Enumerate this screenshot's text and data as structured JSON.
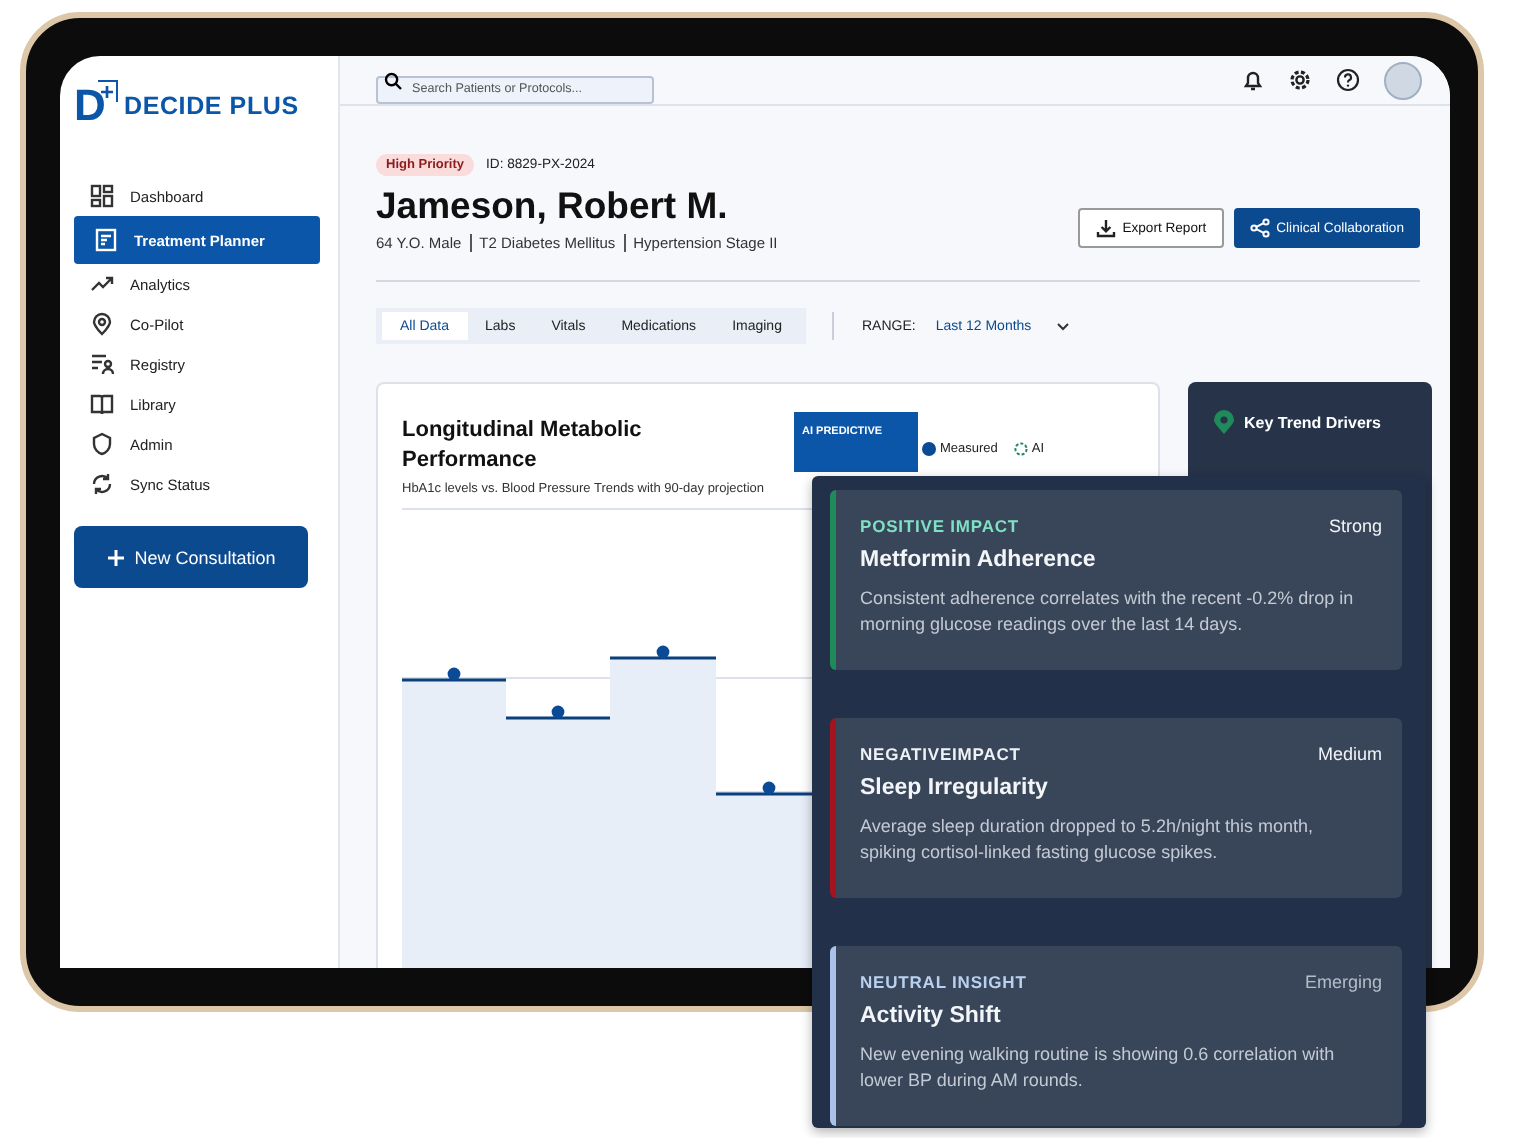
{
  "brand": {
    "letter": "D",
    "sign": "+",
    "name": "DECIDE PLUS"
  },
  "sidebar": {
    "items": [
      {
        "label": "Dashboard",
        "selected": false
      },
      {
        "label": "Treatment Planner",
        "selected": true
      },
      {
        "label": "Analytics",
        "selected": false
      },
      {
        "label": "Co-Pilot",
        "selected": false
      },
      {
        "label": "Registry",
        "selected": false
      },
      {
        "label": "Library",
        "selected": false
      },
      {
        "label": "Admin",
        "selected": false
      },
      {
        "label": "Sync Status",
        "selected": false
      }
    ],
    "action": {
      "label": "New Consultation"
    }
  },
  "search": {
    "placeholder": "Search Patients or Protocols..."
  },
  "patient": {
    "priority": "High Priority",
    "id": "ID: 8829-PX-2024",
    "name": "Jameson, Robert M.",
    "details": [
      "64 Y.O. Male",
      "T2 Diabetes Mellitus",
      "Hypertension Stage II"
    ]
  },
  "actions": [
    {
      "label": "Export Report",
      "kind": "secondary"
    },
    {
      "label": "Clinical Collaboration",
      "kind": "primary"
    }
  ],
  "tabs": [
    {
      "label": "All Data",
      "selected": true
    },
    {
      "label": "Labs",
      "selected": false
    },
    {
      "label": "Vitals",
      "selected": false
    },
    {
      "label": "Medications",
      "selected": false
    },
    {
      "label": "Imaging",
      "selected": false
    }
  ],
  "range": {
    "label": "RANGE:",
    "value": "Last 12 Months"
  },
  "chart": {
    "title": "Longitudinal Metabolic Performance",
    "subtitle": "HbA1c levels vs. Blood Pressure Trends with 90-day projection",
    "badge": "AI PREDICTIVE",
    "legend": [
      {
        "label": "Measured",
        "kind": "measured"
      },
      {
        "label": "AI",
        "kind": "ai"
      }
    ]
  },
  "trend_panel": {
    "title": "Key Trend Drivers"
  },
  "drivers": [
    {
      "kind": "positive",
      "color": "#1f8a5a",
      "label": "POSITIVE IMPACT",
      "strength": "Strong",
      "title": "Metformin Adherence",
      "text": "Consistent adherence correlates with the recent -0.2% drop in morning glucose readings over the last 14 days."
    },
    {
      "kind": "negative",
      "color": "#a3141f",
      "label": "NEGATIVEIMPACT",
      "strength": "Medium",
      "title": "Sleep Irregularity",
      "text": "Average sleep duration dropped to 5.2h/night this month, spiking cortisol-linked fasting glucose spikes."
    },
    {
      "kind": "neutral",
      "color": "#a9c3e8",
      "label": "NEUTRAL INSIGHT",
      "strength": "Emerging",
      "title": "Activity Shift",
      "text": "New evening walking routine is showing 0.6 correlation with lower BP during AM rounds."
    }
  ]
}
